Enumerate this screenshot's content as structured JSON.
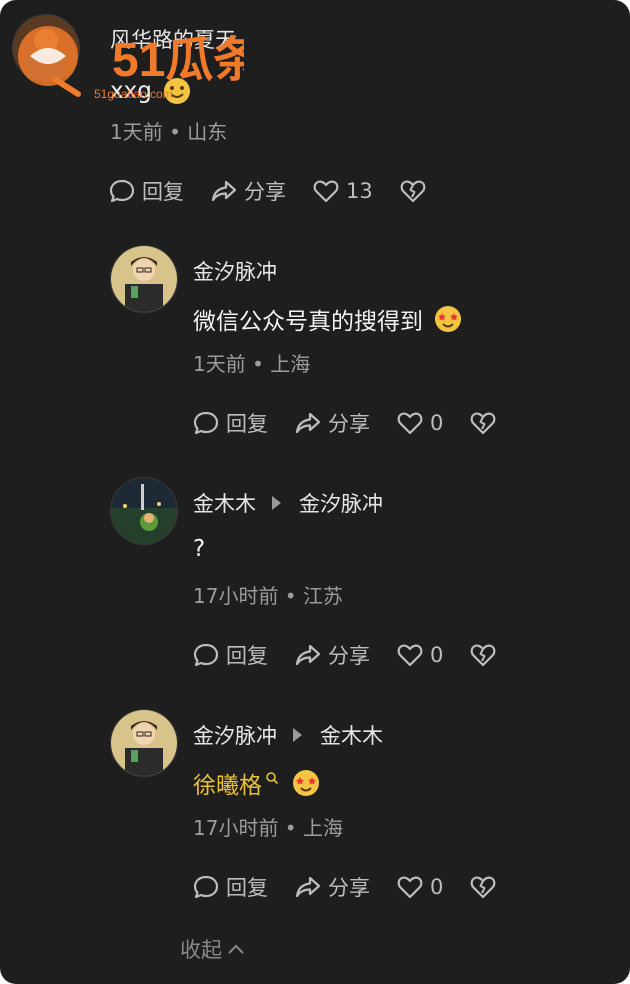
{
  "comments": [
    {
      "author": "风华路的夏天",
      "reply_to": "",
      "text": "xxg",
      "meta": "1天前 • 山东",
      "reply_label": "回复",
      "share_label": "分享",
      "likes": "13"
    },
    {
      "author": "金汐脉冲",
      "reply_to": "",
      "text": "微信公众号真的搜得到",
      "meta": "1天前 • 上海",
      "reply_label": "回复",
      "share_label": "分享",
      "likes": "0"
    },
    {
      "author": "金木木",
      "reply_to": "金汐脉冲",
      "text": "?",
      "meta": "17小时前 • 江苏",
      "reply_label": "回复",
      "share_label": "分享",
      "likes": "0"
    },
    {
      "author": "金汐脉冲",
      "reply_to": "金木木",
      "text": "徐曦格",
      "meta": "17小时前 • 上海",
      "reply_label": "回复",
      "share_label": "分享",
      "likes": "0"
    }
  ],
  "collapse_label": "收起",
  "watermark": {
    "logo_text": "51瓜条",
    "url_text": "51guatiao.com"
  },
  "colors": {
    "background": "#1e1e1e",
    "link": "#e8c23a",
    "watermark": "#f07a2a"
  },
  "icons": [
    "reply-bubble-icon",
    "share-arrow-icon",
    "heart-icon",
    "broken-heart-icon",
    "search-icon",
    "chevron-up-icon"
  ]
}
